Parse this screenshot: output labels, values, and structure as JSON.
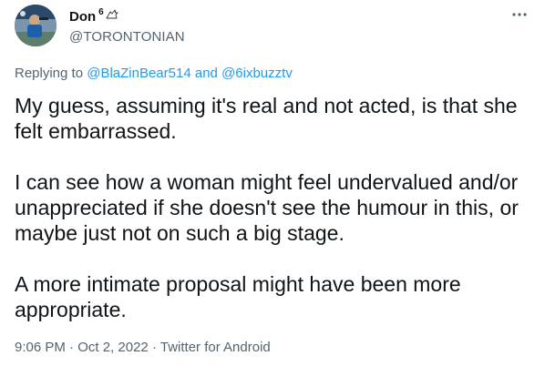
{
  "author": {
    "display_name": "Don",
    "name_suffix": "6",
    "name_emoji": "bird-icon",
    "handle": "@TORONTONIAN"
  },
  "more_menu": {
    "icon": "more-horizontal-icon"
  },
  "reply_context": {
    "prefix": "Replying to",
    "mention_1": "@BlaZinBear514",
    "joiner": "and",
    "mention_2": "@6ixbuzztv"
  },
  "tweet": {
    "paragraphs": [
      "My guess, assuming it's real and not acted, is that she\nfelt embarrassed.",
      "I can see how a woman might feel undervalued and/or\nunappreciated if she doesn't see the humour in this, or\nmaybe just not on such a big stage.",
      "A more intimate proposal might have been more\nappropriate."
    ]
  },
  "meta": {
    "time": "9:06 PM",
    "date": "Oct 2, 2022",
    "source": "Twitter for Android",
    "separator": "·"
  },
  "colors": {
    "text_primary": "#0f1419",
    "text_secondary": "#536471",
    "link": "#1d9bf0"
  }
}
